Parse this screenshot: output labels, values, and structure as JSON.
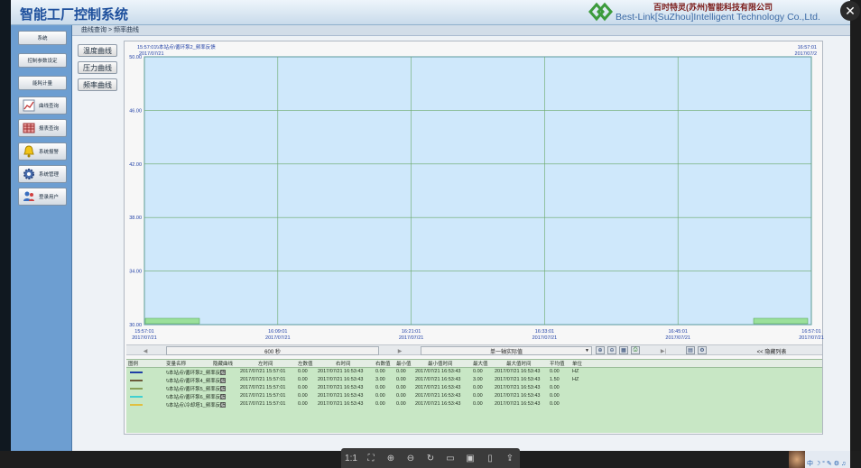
{
  "app": {
    "title": "智能工厂控制系统",
    "company_cn": "百时特灵(苏州)智能科技有限公司",
    "company_en": "Best-Link[SuZhou]Intelligent Technology Co.,Ltd."
  },
  "sidebar": {
    "items": [
      {
        "label": "系统",
        "icon": null
      },
      {
        "label": "控制参数设定",
        "icon": null
      },
      {
        "label": "能耗计量",
        "icon": null
      },
      {
        "label": "曲线查询",
        "icon": "line-chart-icon"
      },
      {
        "label": "报表查询",
        "icon": "table-report-icon"
      },
      {
        "label": "系统报警",
        "icon": "alarm-bell-icon"
      },
      {
        "label": "系统管理",
        "icon": "gear-icon"
      },
      {
        "label": "登录用户",
        "icon": "users-icon"
      }
    ]
  },
  "breadcrumb": "曲线查询 > 频率曲线",
  "curve_buttons": [
    "温度曲线",
    "压力曲线",
    "频率曲线"
  ],
  "chart_header": {
    "left_time": "15:57:01",
    "series_name": "\\\\本站点\\循环泵2_频率反馈",
    "left_date": "2017/07/21",
    "right_time": "16:57:01",
    "right_date": "2017/07/2"
  },
  "chart_data": {
    "type": "line",
    "ylim": [
      30.0,
      50.0
    ],
    "y_ticks": [
      "50.00",
      "46.00",
      "42.00",
      "38.00",
      "34.00",
      "30.00"
    ],
    "x_ticks": [
      {
        "time": "15:57:01",
        "date": "2017/07/21"
      },
      {
        "time": "16:09:01",
        "date": "2017/07/21"
      },
      {
        "time": "16:21:01",
        "date": "2017/07/21"
      },
      {
        "time": "16:33:01",
        "date": "2017/07/21"
      },
      {
        "time": "16:45:01",
        "date": "2017/07/21"
      },
      {
        "time": "16:57:01",
        "date": "2017/07/21"
      }
    ],
    "grid": true,
    "series": []
  },
  "toolbar": {
    "span": "600  秒",
    "axis_mode": "单一轴实际值",
    "hide_list": "<< 隐藏列表"
  },
  "legend_table": {
    "headers": [
      "图例",
      "变量名称",
      "隐藏曲线",
      "左时间",
      "左数值",
      "右时间",
      "右数值",
      "最小值",
      "最小值时间",
      "最大值",
      "最大值时间",
      "平均值",
      "单位"
    ],
    "rows": [
      {
        "color": "#1f3fa6",
        "name": "\\\\本站点\\循环泵2_频率反馈",
        "left_time": "2017/07/21 15:57:01",
        "left_val": "0.00",
        "right_time": "2017/07/21 16:53:43",
        "right_val": "0.00",
        "min": "0.00",
        "min_time": "2017/07/21 16:53:43",
        "max": "0.00",
        "max_time": "2017/07/21 16:53:43",
        "avg": "0.00",
        "unit": "HZ"
      },
      {
        "color": "#6b5a3a",
        "name": "\\\\本站点\\循环泵4_频率反馈",
        "left_time": "2017/07/21 15:57:01",
        "left_val": "0.00",
        "right_time": "2017/07/21 16:53:43",
        "right_val": "3.00",
        "min": "0.00",
        "min_time": "2017/07/21 16:53:43",
        "max": "3.00",
        "max_time": "2017/07/21 16:53:43",
        "avg": "1.50",
        "unit": "HZ"
      },
      {
        "color": "#8aa05a",
        "name": "\\\\本站点\\循环泵5_频率反馈",
        "left_time": "2017/07/21 15:57:01",
        "left_val": "0.00",
        "right_time": "2017/07/21 16:53:43",
        "right_val": "0.00",
        "min": "0.00",
        "min_time": "2017/07/21 16:53:43",
        "max": "0.00",
        "max_time": "2017/07/21 16:53:43",
        "avg": "0.00",
        "unit": ""
      },
      {
        "color": "#40d0d0",
        "name": "\\\\本站点\\循环泵6_频率反馈",
        "left_time": "2017/07/21 15:57:01",
        "left_val": "0.00",
        "right_time": "2017/07/21 16:53:43",
        "right_val": "0.00",
        "min": "0.00",
        "min_time": "2017/07/21 16:53:43",
        "max": "0.00",
        "max_time": "2017/07/21 16:53:43",
        "avg": "0.00",
        "unit": ""
      },
      {
        "color": "#e0c040",
        "name": "\\\\本站点\\冷却塔1_频率反馈",
        "left_time": "2017/07/21 15:57:01",
        "left_val": "0.00",
        "right_time": "2017/07/21 16:53:43",
        "right_val": "0.00",
        "min": "0.00",
        "min_time": "2017/07/21 16:53:43",
        "max": "0.00",
        "max_time": "2017/07/21 16:53:43",
        "avg": "0.00",
        "unit": ""
      }
    ]
  },
  "viewer_bar": {
    "items": [
      "1:1",
      "⛶",
      "⊕",
      "⊖",
      "↻",
      "▭",
      "▣",
      "▯",
      "⇪"
    ]
  }
}
